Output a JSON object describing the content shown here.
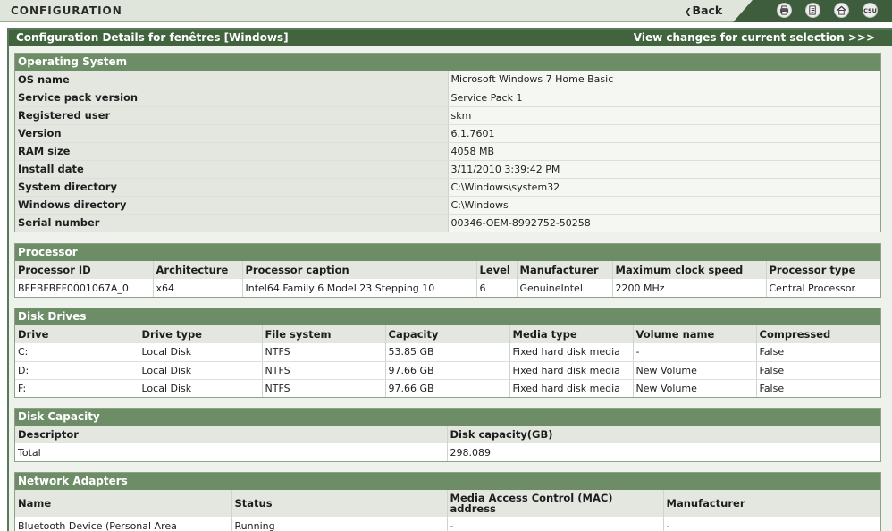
{
  "app": {
    "title": "CONFIGURATION",
    "back_label": "Back",
    "toolbar": [
      "print-icon",
      "export-icon",
      "home-icon",
      "csu-icon"
    ],
    "csu_label": "CSU"
  },
  "panel": {
    "title": "Configuration Details for fenêtres [Windows]",
    "view_changes_link": "View changes for current selection >>>"
  },
  "os": {
    "title": "Operating System",
    "rows": [
      {
        "label": "OS name",
        "value": "Microsoft Windows 7 Home Basic"
      },
      {
        "label": "Service pack version",
        "value": "Service Pack 1"
      },
      {
        "label": "Registered user",
        "value": "skm"
      },
      {
        "label": "Version",
        "value": "6.1.7601"
      },
      {
        "label": "RAM size",
        "value": "4058 MB"
      },
      {
        "label": "Install date",
        "value": "3/11/2010 3:39:42 PM"
      },
      {
        "label": "System directory",
        "value": "C:\\Windows\\system32"
      },
      {
        "label": "Windows directory",
        "value": "C:\\Windows"
      },
      {
        "label": "Serial number",
        "value": "00346-OEM-8992752-50258"
      }
    ]
  },
  "processor": {
    "title": "Processor",
    "columns": [
      "Processor ID",
      "Architecture",
      "Processor caption",
      "Level",
      "Manufacturer",
      "Maximum clock speed",
      "Processor type"
    ],
    "rows": [
      [
        "BFEBFBFF0001067A_0",
        "x64",
        "Intel64 Family 6 Model 23 Stepping 10",
        "6",
        "GenuineIntel",
        "2200 MHz",
        "Central Processor"
      ]
    ]
  },
  "disks": {
    "title": "Disk Drives",
    "columns": [
      "Drive",
      "Drive type",
      "File system",
      "Capacity",
      "Media type",
      "Volume name",
      "Compressed"
    ],
    "rows": [
      [
        "C:",
        "Local Disk",
        "NTFS",
        "53.85 GB",
        "Fixed hard disk media",
        "-",
        "False"
      ],
      [
        "D:",
        "Local Disk",
        "NTFS",
        "97.66 GB",
        "Fixed hard disk media",
        "New Volume",
        "False"
      ],
      [
        "F:",
        "Local Disk",
        "NTFS",
        "97.66 GB",
        "Fixed hard disk media",
        "New Volume",
        "False"
      ]
    ]
  },
  "capacity": {
    "title": "Disk Capacity",
    "columns": [
      "Descriptor",
      "Disk capacity(GB)"
    ],
    "rows": [
      [
        "Total",
        "298.089"
      ]
    ]
  },
  "network": {
    "title": "Network Adapters",
    "columns": [
      "Name",
      "Status",
      "Media Access Control (MAC) address",
      "Manufacturer"
    ],
    "rows": [
      [
        "Bluetooth Device (Personal Area",
        "Running",
        "-",
        "-"
      ]
    ]
  }
}
